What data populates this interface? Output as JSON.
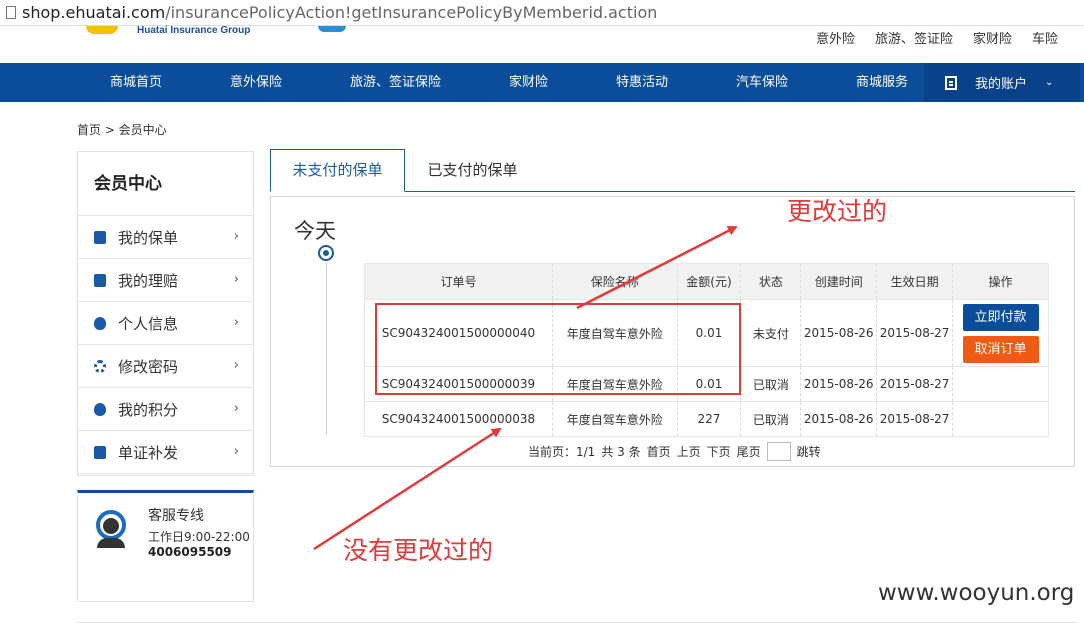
{
  "browser": {
    "url_host": "shop.ehuatai.com",
    "url_path": "/insurancePolicyAction!getInsurancePolicyByMemberid.action"
  },
  "header": {
    "logo_text": "Huatai Insurance Group",
    "top_links": [
      "意外险",
      "旅游、签证险",
      "家财险",
      "车险"
    ]
  },
  "nav": {
    "items": [
      "商城首页",
      "意外保险",
      "旅游、签证保险",
      "家财险",
      "特惠活动",
      "汽车保险",
      "商城服务"
    ],
    "account_label": "我的账户"
  },
  "breadcrumb": "首页 > 会员中心",
  "sidebar": {
    "title": "会员中心",
    "items": [
      {
        "label": "我的保单",
        "icon": "document-icon"
      },
      {
        "label": "我的理赔",
        "icon": "claim-icon"
      },
      {
        "label": "个人信息",
        "icon": "money-bag-icon"
      },
      {
        "label": "修改密码",
        "icon": "gear-icon"
      },
      {
        "label": "我的积分",
        "icon": "money-bag-icon"
      },
      {
        "label": "单证补发",
        "icon": "document-icon"
      }
    ]
  },
  "service": {
    "title": "客服专线",
    "hours": "工作日9:00-22:00",
    "phone": "4006095509"
  },
  "tabs": {
    "unpaid": "未支付的保单",
    "paid": "已支付的保单"
  },
  "timeline": {
    "label": "今天"
  },
  "table": {
    "headers": [
      "订单号",
      "保险名称",
      "金额(元)",
      "状态",
      "创建时间",
      "生效日期",
      "操作"
    ],
    "rows": [
      {
        "order": "SC904324001500000040",
        "name": "年度自驾车意外险",
        "amount": "0.01",
        "status": "未支付",
        "created": "2015-08-26",
        "effective": "2015-08-27",
        "pay_label": "立即付款",
        "cancel_label": "取消订单"
      },
      {
        "order": "SC904324001500000039",
        "name": "年度自驾车意外险",
        "amount": "0.01",
        "status": "已取消",
        "created": "2015-08-26",
        "effective": "2015-08-27"
      },
      {
        "order": "SC904324001500000038",
        "name": "年度自驾车意外险",
        "amount": "227",
        "status": "已取消",
        "created": "2015-08-26",
        "effective": "2015-08-27"
      }
    ]
  },
  "pager": {
    "current": "当前页：1/1",
    "total": "共 3 条",
    "first": "首页",
    "prev": "上页",
    "next": "下页",
    "last": "尾页",
    "jump": "跳转"
  },
  "annotations": {
    "changed": "更改过的",
    "unchanged": "没有更改过的",
    "color": "#e03a3a"
  },
  "watermark": "www.wooyun.org",
  "colors": {
    "nav_bg": "#0c4d9b",
    "pay_button": "#0c4d9b",
    "cancel_button": "#f05a14"
  }
}
